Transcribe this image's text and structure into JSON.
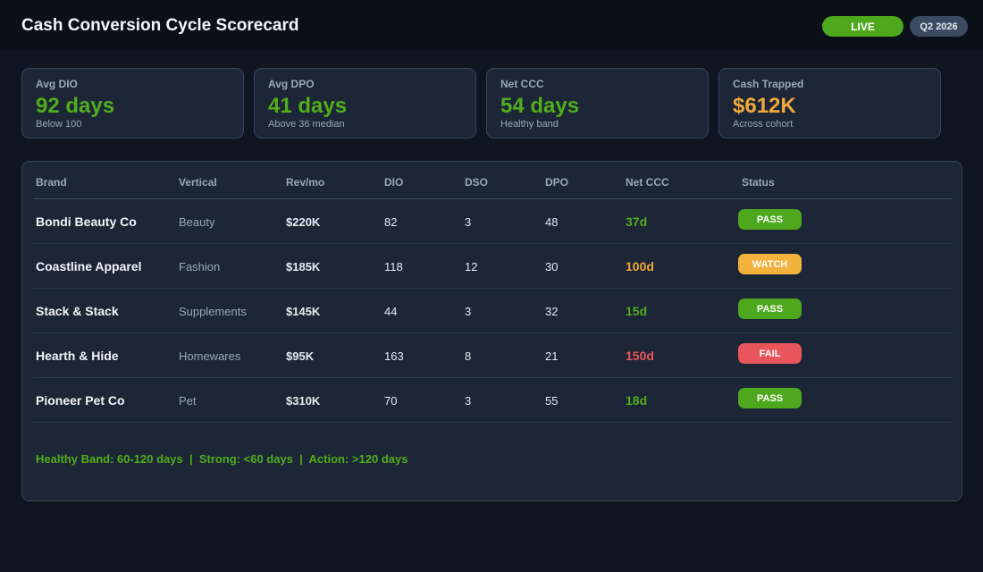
{
  "header": {
    "title": "Cash Conversion Cycle Scorecard",
    "live_label": "LIVE",
    "period_label": "Q2 2026"
  },
  "kpis": [
    {
      "label": "Avg DIO",
      "value": "92 days",
      "sub": "Below 100",
      "tone": "green"
    },
    {
      "label": "Avg DPO",
      "value": "41 days",
      "sub": "Above 36 median",
      "tone": "green"
    },
    {
      "label": "Net CCC",
      "value": "54 days",
      "sub": "Healthy band",
      "tone": "green"
    },
    {
      "label": "Cash Trapped",
      "value": "$612K",
      "sub": "Across cohort",
      "tone": "amber"
    }
  ],
  "table": {
    "columns": [
      "Brand",
      "Vertical",
      "Rev/mo",
      "DIO",
      "DSO",
      "DPO",
      "Net CCC",
      "Status"
    ],
    "rows": [
      {
        "brand": "Bondi Beauty Co",
        "vertical": "Beauty",
        "rev": "$220K",
        "dio": "82",
        "dso": "3",
        "dpo": "48",
        "ccc": "37d",
        "status": "PASS",
        "tone": "green"
      },
      {
        "brand": "Coastline Apparel",
        "vertical": "Fashion",
        "rev": "$185K",
        "dio": "118",
        "dso": "12",
        "dpo": "30",
        "ccc": "100d",
        "status": "WATCH",
        "tone": "amber"
      },
      {
        "brand": "Stack & Stack",
        "vertical": "Supplements",
        "rev": "$145K",
        "dio": "44",
        "dso": "3",
        "dpo": "32",
        "ccc": "15d",
        "status": "PASS",
        "tone": "green"
      },
      {
        "brand": "Hearth & Hide",
        "vertical": "Homewares",
        "rev": "$95K",
        "dio": "163",
        "dso": "8",
        "dpo": "21",
        "ccc": "150d",
        "status": "FAIL",
        "tone": "red"
      },
      {
        "brand": "Pioneer Pet Co",
        "vertical": "Pet",
        "rev": "$310K",
        "dio": "70",
        "dso": "3",
        "dpo": "55",
        "ccc": "18d",
        "status": "PASS",
        "tone": "green"
      }
    ]
  },
  "footer_note": "Healthy Band: 60-120 days  |  Strong: <60 days  |  Action: >120 days",
  "colors": {
    "green": "#52ad1c",
    "amber": "#f0a93a",
    "red": "#e8565c",
    "badge_green": "#4ea81e",
    "badge_amber": "#f2b23e",
    "badge_red": "#e8565c"
  }
}
